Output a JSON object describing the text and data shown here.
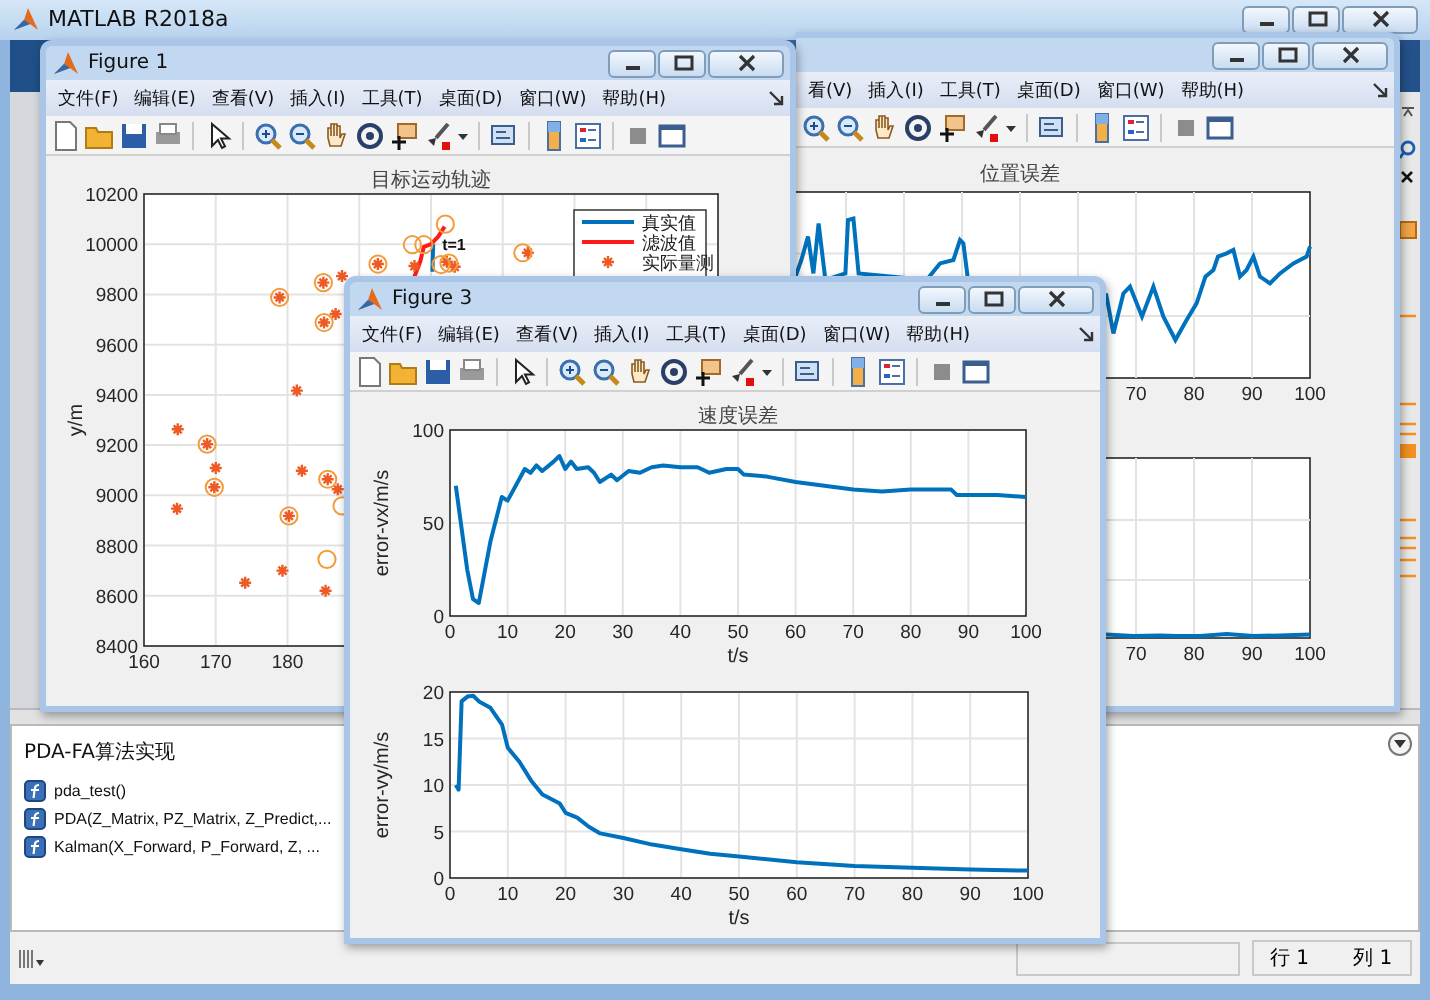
{
  "main_window": {
    "title": "MATLAB R2018a"
  },
  "figure_2": {
    "menu": [
      "看(V)",
      "插入(I)",
      "工具(T)",
      "桌面(D)",
      "窗口(W)",
      "帮助(H)"
    ],
    "plots": [
      {
        "title": "位置误差",
        "xtick_labels": [
          "70",
          "80",
          "90",
          "100"
        ]
      },
      {
        "xtick_labels": [
          "70",
          "80",
          "90",
          "100"
        ]
      }
    ]
  },
  "figure_1": {
    "title": "Figure 1",
    "menu": [
      "文件(F)",
      "编辑(E)",
      "查看(V)",
      "插入(I)",
      "工具(T)",
      "桌面(D)",
      "窗口(W)",
      "帮助(H)"
    ],
    "chart_data": {
      "type": "scatter",
      "title": "目标运动轨迹",
      "ylabel": "y/m",
      "grid": true,
      "legend": "upper right",
      "xlim": [
        160,
        240
      ],
      "ylim": [
        8400,
        10200
      ],
      "xticks": [
        160,
        170,
        180
      ],
      "yticks": [
        8400,
        8600,
        8800,
        9000,
        9200,
        9400,
        9600,
        9800,
        10000,
        10200
      ],
      "x": [
        164.6,
        164.7,
        168.8,
        169.8,
        170,
        174.1,
        178.9,
        179.3,
        180.2,
        181.3,
        182,
        185,
        185.1,
        185.3,
        185.5,
        185.6,
        186.7,
        187,
        187.6,
        192.6,
        197.4,
        197.7,
        198.5,
        199,
        200,
        200.2,
        200.3,
        201,
        201.4,
        201.9,
        202,
        202.2,
        202.5,
        203.3,
        212.8,
        213.5
      ],
      "series": [
        {
          "name": "真实值",
          "color": "#0072bd",
          "type": "line",
          "values": [
            null,
            null,
            null,
            null,
            null,
            null,
            null,
            null,
            null,
            null,
            null,
            null,
            null,
            null,
            null,
            null,
            null,
            null,
            null,
            null,
            null,
            null,
            null,
            null,
            null,
            9890,
            10000,
            null,
            null,
            null,
            null,
            null,
            null,
            null,
            null,
            null
          ]
        },
        {
          "name": "滤波值",
          "color": "#ff1a1a",
          "type": "line",
          "values": [
            null,
            null,
            null,
            null,
            null,
            null,
            null,
            null,
            null,
            null,
            null,
            null,
            null,
            null,
            null,
            null,
            null,
            null,
            null,
            null,
            null,
            9870,
            9930,
            9990,
            10000,
            null,
            null,
            10030,
            null,
            10070,
            null,
            null,
            null,
            null,
            null,
            null
          ]
        },
        {
          "name": "实际量测",
          "color": "#ee5a24",
          "type": "scatter",
          "marker": "cross",
          "values": [
            8947,
            9263,
            9204,
            9032,
            9109,
            8652,
            9788,
            8700,
            8918,
            9417,
            9098,
            9847,
            9688,
            8620,
            null,
            9064,
            9722,
            9024,
            9873,
            9921,
            null,
            9913,
            null,
            null,
            null,
            null,
            null,
            null,
            null,
            null,
            null,
            9930,
            null,
            9910,
            null,
            9966
          ]
        },
        {
          "color": "#f39c3c",
          "type": "scatter",
          "marker": "circle",
          "values": [
            null,
            null,
            9204,
            9032,
            null,
            null,
            9788,
            null,
            8918,
            null,
            null,
            9847,
            9688,
            null,
            8745,
            9064,
            null,
            null,
            8958,
            9921,
            9998,
            null,
            null,
            9998,
            null,
            null,
            null,
            null,
            9919,
            null,
            10080,
            null,
            9925,
            null,
            9966,
            null
          ]
        }
      ],
      "annotations": [
        {
          "text": "t=1"
        }
      ]
    }
  },
  "figure_3": {
    "title": "Figure 3",
    "menu": [
      "文件(F)",
      "编辑(E)",
      "查看(V)",
      "插入(I)",
      "工具(T)",
      "桌面(D)",
      "窗口(W)",
      "帮助(H)"
    ],
    "charts": [
      {
        "chart_data": {
          "type": "line",
          "title": "速度误差",
          "xlabel": "t/s",
          "ylabel": "error-vx/m/s",
          "grid": true,
          "xlim": [
            0,
            100
          ],
          "ylim": [
            0,
            100
          ],
          "xticks": [
            0,
            10,
            20,
            30,
            40,
            50,
            60,
            70,
            80,
            90,
            100
          ],
          "yticks": [
            0,
            50,
            100
          ],
          "x": [
            1,
            3,
            4,
            5,
            7,
            9,
            10,
            13,
            14,
            15,
            16,
            18,
            19,
            20,
            21,
            22,
            24,
            25,
            26,
            28,
            29,
            31,
            33,
            35,
            37,
            40,
            43,
            45,
            48,
            50,
            51,
            55,
            60,
            65,
            70,
            75,
            80,
            87,
            88,
            95,
            100
          ],
          "series": [
            {
              "color": "#0072bd",
              "values": [
                70,
                25,
                9,
                7,
                40,
                64,
                62,
                79,
                77,
                81,
                78,
                83,
                86,
                79,
                83,
                79,
                80,
                77,
                72,
                76,
                73,
                78,
                77,
                80,
                81,
                80,
                80,
                77,
                79,
                79,
                76,
                75,
                72,
                70,
                68,
                67,
                68,
                68,
                65,
                65,
                64
              ]
            }
          ]
        }
      },
      {
        "chart_data": {
          "type": "line",
          "xlabel": "t/s",
          "ylabel": "error-vy/m/s",
          "grid": true,
          "xlim": [
            0,
            100
          ],
          "ylim": [
            0,
            20
          ],
          "xticks": [
            0,
            10,
            20,
            30,
            40,
            50,
            60,
            70,
            80,
            90,
            100
          ],
          "yticks": [
            0,
            5,
            10,
            15,
            20
          ],
          "x": [
            1,
            1.5,
            2,
            3,
            4,
            5,
            7,
            9,
            10,
            12,
            14,
            16,
            19,
            20,
            22,
            24,
            26,
            30,
            35,
            40,
            45,
            50,
            60,
            70,
            80,
            90,
            100
          ],
          "series": [
            {
              "color": "#0072bd",
              "values": [
                10,
                9.5,
                19,
                19.5,
                19.6,
                19,
                18.3,
                16.5,
                14,
                12.5,
                10.5,
                9,
                8,
                7,
                6.5,
                5.5,
                4.8,
                4.3,
                3.6,
                3.1,
                2.6,
                2.3,
                1.7,
                1.3,
                1.1,
                0.9,
                0.8
              ]
            }
          ]
        }
      }
    ]
  },
  "details_panel": {
    "heading": "PDA-FA算法实现",
    "functions": [
      "pda_test()",
      "PDA(Z_Matrix, PZ_Matrix, Z_Predict,...",
      "Kalman(X_Forward, P_Forward, Z, ..."
    ]
  },
  "status_bar": {
    "line": "行 1",
    "column": "列 1"
  }
}
